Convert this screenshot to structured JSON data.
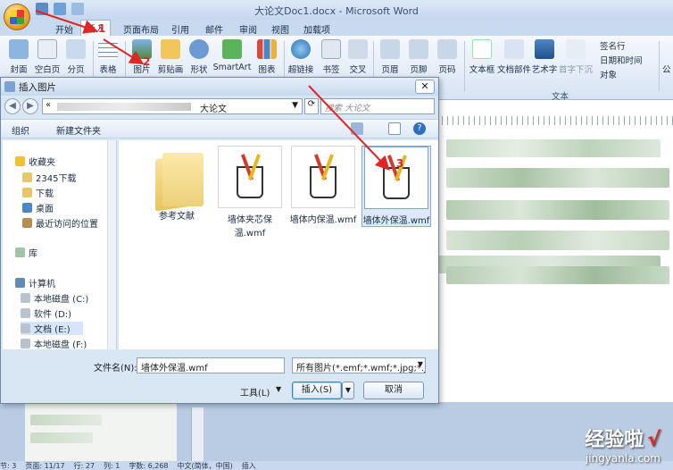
{
  "window": {
    "title": "大论文Doc1.docx - Microsoft Word"
  },
  "ribbon": {
    "tabs": [
      "开始",
      "插入",
      "页面布局",
      "引用",
      "邮件",
      "审阅",
      "视图",
      "加载项"
    ],
    "active_tab": "插入",
    "buttons": [
      "封面",
      "空白页",
      "分页",
      "表格",
      "图片",
      "剪贴画",
      "形状",
      "SmartArt",
      "图表",
      "超链接",
      "书签",
      "交叉",
      "页眉",
      "页脚",
      "页码",
      "文本框",
      "文档部件",
      "艺术字",
      "首字下沉"
    ],
    "small_buttons": [
      "签名行",
      "日期和时间",
      "对象"
    ],
    "group_label_text": "文本",
    "right_cut": "公"
  },
  "dialog": {
    "title": "插入图片",
    "close_glyph": "✕",
    "address": {
      "prefix": "«",
      "crumb": "大论文"
    },
    "search_placeholder": "搜索 大论文",
    "toolbar": {
      "organize": "组织",
      "new_folder": "新建文件夹"
    },
    "nav": {
      "favorites": "收藏夹",
      "items": [
        "2345下载",
        "下载",
        "桌面",
        "最近访问的位置"
      ],
      "library": "库",
      "computer": "计算机",
      "drives": [
        "本地磁盘 (C:)",
        "软件 (D:)",
        "文档 (E:)",
        "本地磁盘 (F:)"
      ],
      "selected_drive": "文档 (E:)"
    },
    "files": [
      {
        "name": "参考文献",
        "type": "folder"
      },
      {
        "name": "墙体夹芯保温.wmf",
        "type": "wmf"
      },
      {
        "name": "墙体内保温.wmf",
        "type": "wmf"
      },
      {
        "name": "墙体外保温.wmf",
        "type": "wmf",
        "selected": true
      }
    ],
    "filename_label": "文件名(N):",
    "filename_value": "墙体外保温.wmf",
    "filetype_value": "所有图片(*.emf;*.wmf;*.jpg;*.jp",
    "tools_label": "工具(L)",
    "insert_label": "插入(S)",
    "cancel_label": "取消"
  },
  "annotations": {
    "step1": "1",
    "step2": "2",
    "step3": "3"
  },
  "status": {
    "items": [
      "节: 3",
      "页面: 11/17",
      "行: 27",
      "列: 1",
      "字数: 6,268",
      "中文(简体，中国)",
      "插入"
    ]
  },
  "watermark": {
    "cn": "经验啦",
    "check": "√",
    "en": "jingyanla.com"
  },
  "colors": {
    "annotation": "#e02525",
    "selection": "#dbe9f9"
  }
}
